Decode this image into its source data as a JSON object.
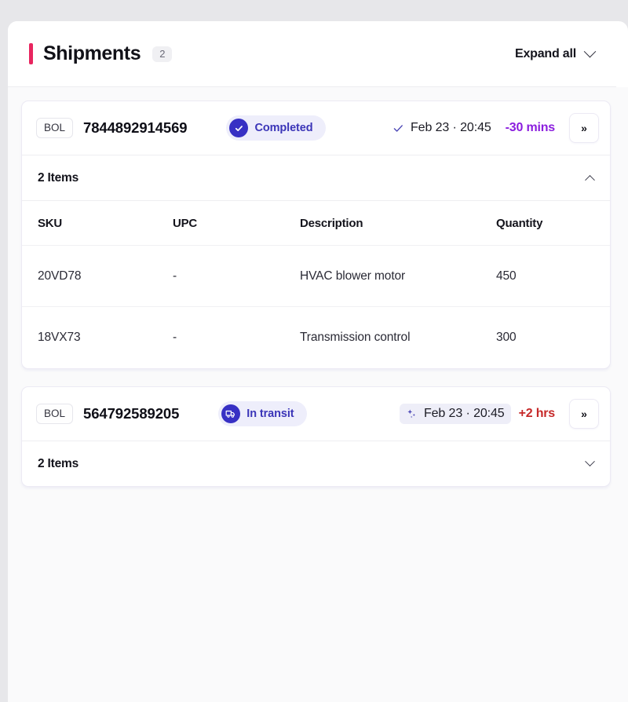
{
  "header": {
    "title": "Shipments",
    "count": "2",
    "expand_all_label": "Expand all",
    "accent_color": "#e8255f"
  },
  "table_columns": [
    "SKU",
    "UPC",
    "Description",
    "Quantity"
  ],
  "shipments": [
    {
      "bol_tag": "BOL",
      "bol_number": "7844892914569",
      "status": {
        "label": "Completed",
        "icon": "check-circle-icon",
        "bg": "#eeeefb",
        "fg": "#3b35b8"
      },
      "eta": {
        "icon": "check-icon",
        "date": "Feb 23 · 20:45",
        "delta": "-30 mins",
        "delta_color": "#8b1ede",
        "highlighted": false
      },
      "expand_button": "»",
      "items_label": "2 Items",
      "expanded": true,
      "items": [
        {
          "sku": "20VD78",
          "upc": "-",
          "description": "HVAC blower motor",
          "quantity": "450"
        },
        {
          "sku": "18VX73",
          "upc": "-",
          "description": "Transmission control",
          "quantity": "300"
        }
      ]
    },
    {
      "bol_tag": "BOL",
      "bol_number": "564792589205",
      "status": {
        "label": "In transit",
        "icon": "truck-circle-icon",
        "bg": "#eeeefb",
        "fg": "#3b35b8"
      },
      "eta": {
        "icon": "sparkle-icon",
        "date": "Feb 23 · 20:45",
        "delta": "+2 hrs",
        "delta_color": "#c62828",
        "highlighted": true
      },
      "expand_button": "»",
      "items_label": "2 Items",
      "expanded": false,
      "items": []
    }
  ]
}
